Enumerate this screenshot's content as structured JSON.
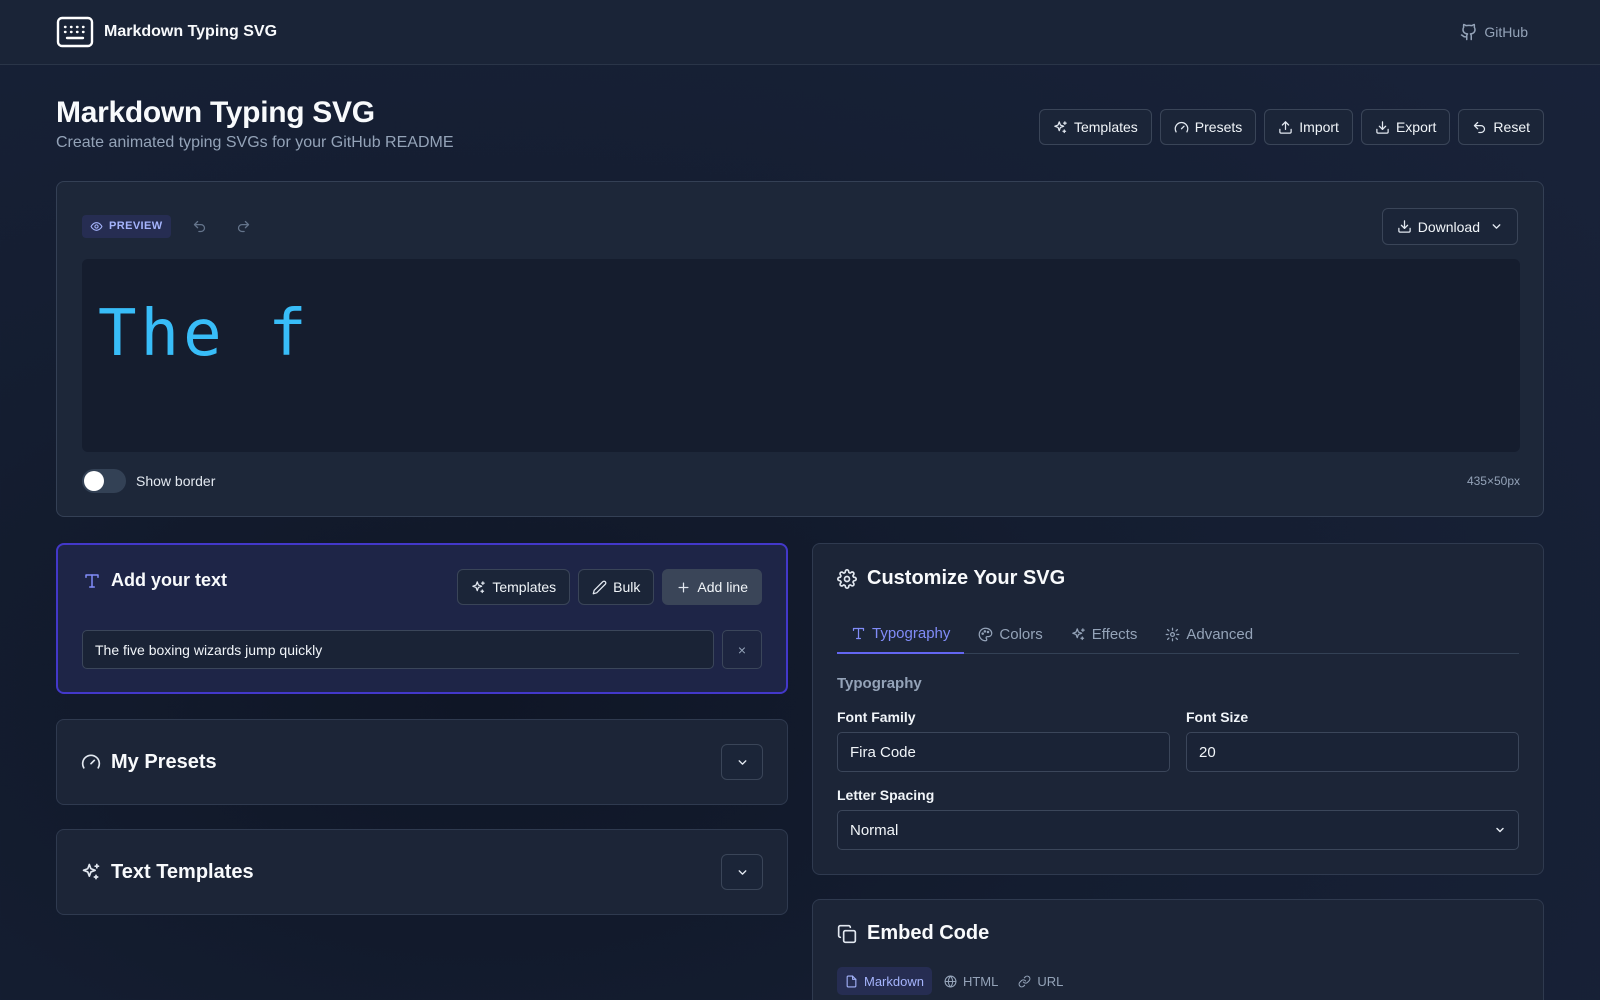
{
  "app": {
    "name": "Markdown Typing SVG",
    "github_label": "GitHub"
  },
  "header": {
    "title": "Markdown Typing SVG",
    "subtitle": "Create animated typing SVGs for your GitHub README",
    "actions": {
      "templates": "Templates",
      "presets": "Presets",
      "import": "Import",
      "export": "Export",
      "reset": "Reset"
    }
  },
  "preview": {
    "badge": "PREVIEW",
    "download_label": "Download",
    "typed_text": "The f",
    "show_border_label": "Show border",
    "show_border_on": false,
    "dimensions": "435×50px",
    "text_color": "#38bdf8"
  },
  "text_card": {
    "title": "Add your text",
    "templates_label": "Templates",
    "bulk_label": "Bulk",
    "add_line_label": "Add line",
    "lines": [
      "The five boxing wizards jump quickly"
    ],
    "remove_symbol": "×"
  },
  "my_presets": {
    "title": "My Presets"
  },
  "text_templates": {
    "title": "Text Templates"
  },
  "customize": {
    "title": "Customize Your SVG",
    "tabs": [
      "Typography",
      "Colors",
      "Effects",
      "Advanced"
    ],
    "active_tab": "Typography",
    "section_label": "Typography",
    "font_family_label": "Font Family",
    "font_family_value": "Fira Code",
    "font_size_label": "Font Size",
    "font_size_value": "20",
    "letter_spacing_label": "Letter Spacing",
    "letter_spacing_value": "Normal"
  },
  "embed": {
    "title": "Embed Code",
    "tabs": [
      "Markdown",
      "HTML",
      "URL"
    ],
    "active_tab": "Markdown"
  },
  "colors": {
    "accent": "#6366f1",
    "accent_text": "#818cf8",
    "background": "#151e31",
    "card": "#1c2537"
  },
  "icons": {
    "logo": "keyboard-icon",
    "github": "github-icon",
    "templates": "sparkles-icon",
    "presets": "gauge-icon",
    "import": "upload-icon",
    "export": "download-icon",
    "reset": "undo-icon",
    "preview": "eye-icon",
    "redo": "redo-icon",
    "text": "type-icon",
    "bulk": "pencil-icon",
    "add": "plus-icon",
    "customize": "gear-icon",
    "colors": "palette-icon",
    "embed": "copy-icon",
    "markdown": "file-icon",
    "html": "globe-icon",
    "url": "link-icon"
  }
}
